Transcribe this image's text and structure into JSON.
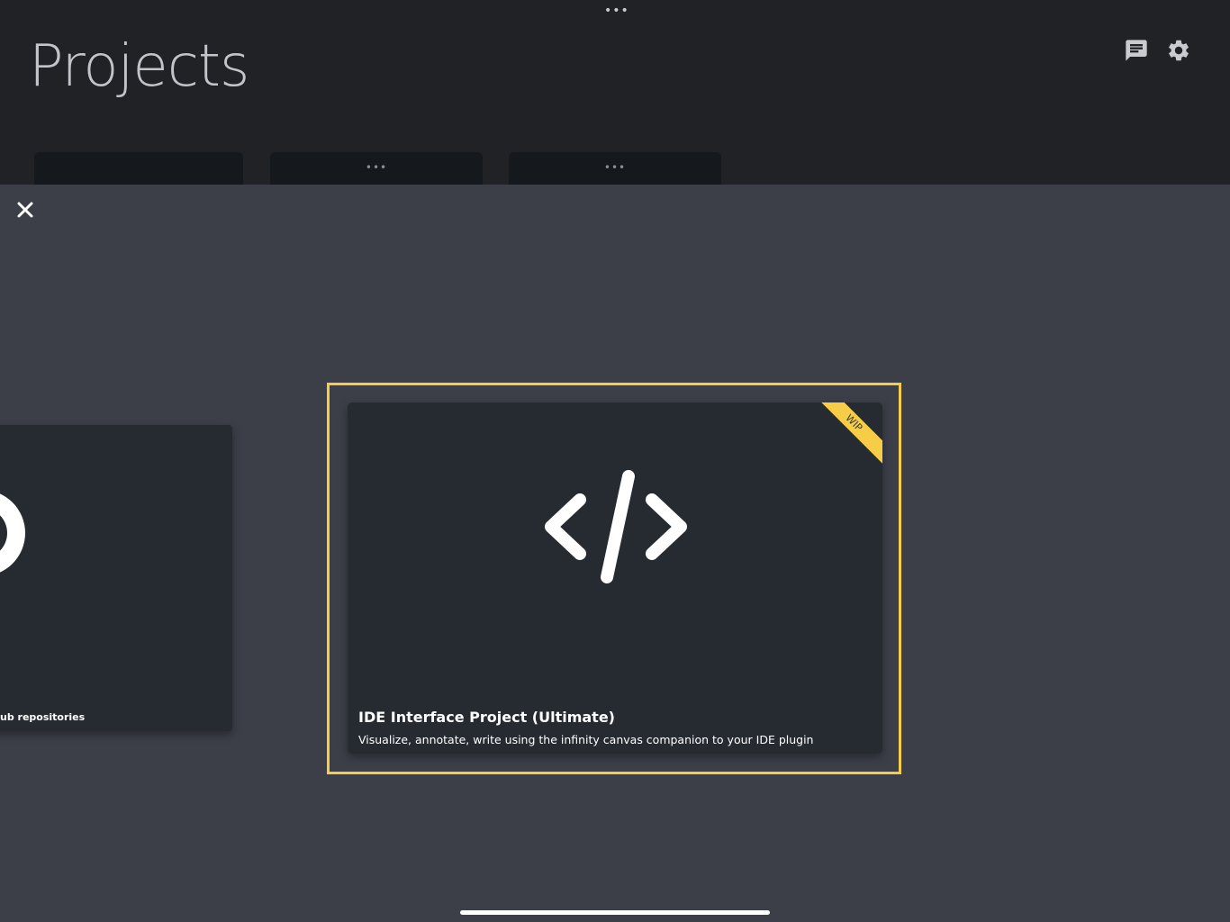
{
  "header": {
    "menu_dots": "•••",
    "title": "Projects",
    "chat_icon": "chat-icon",
    "settings_icon": "gear-icon"
  },
  "project_tabs": [
    {
      "dots": ""
    },
    {
      "dots": "•••"
    },
    {
      "dots": "•••"
    }
  ],
  "modal": {
    "close_icon": "close-icon",
    "side_card": {
      "icon": "github-icon",
      "caption": "ub repositories"
    },
    "selected_card": {
      "icon": "code-icon",
      "badge": "WIP",
      "title": "IDE Interface Project (Ultimate)",
      "description": "Visualize, annotate, write using the infinity canvas companion to your IDE plugin"
    }
  },
  "colors": {
    "accent": "#f7cd48",
    "background": "#3c3f48",
    "header_bg": "#212226",
    "card_bg": "#262b32"
  }
}
